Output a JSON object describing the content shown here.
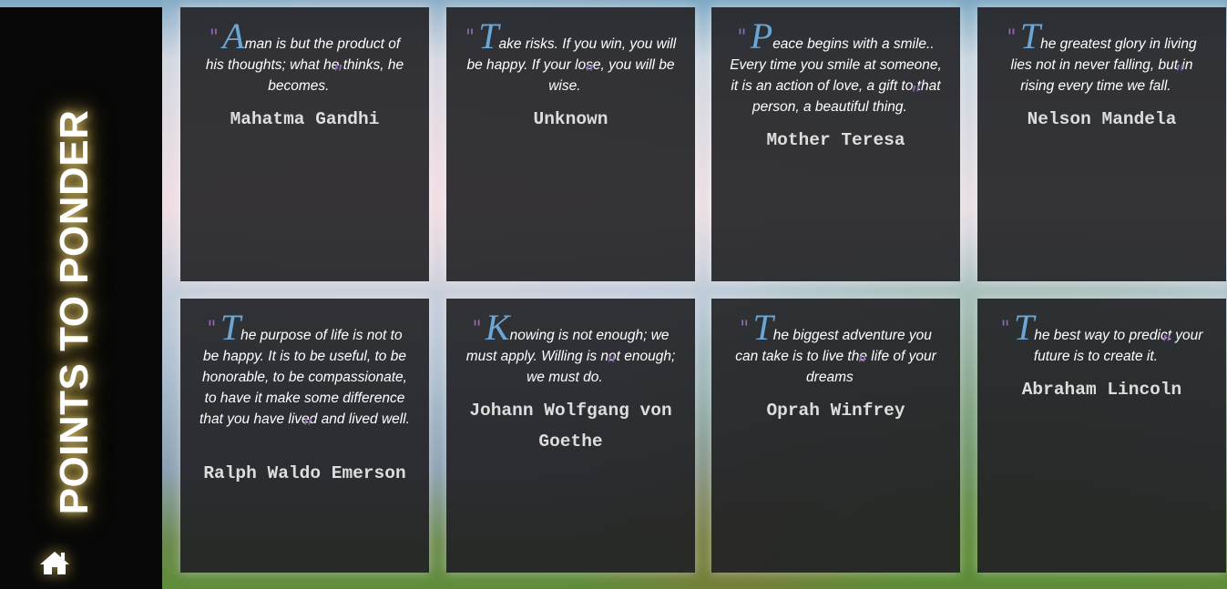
{
  "title": "POINTS TO PONDER",
  "home_icon": "home-icon",
  "quotes": [
    {
      "first": "A",
      "rest": "man is but the product of his thoughts; what he thinks, he becomes.",
      "author": "Mahatma Gandhi"
    },
    {
      "first": "T",
      "rest": "ake risks. If you win, you will be happy. If your lose, you will be wise.",
      "author": "Unknown"
    },
    {
      "first": "P",
      "rest": "eace begins with a smile.. Every time you smile at someone, it is an action of love, a gift to that person, a beautiful thing.",
      "author": "Mother Teresa"
    },
    {
      "first": "T",
      "rest": "he greatest glory in living lies not in never falling, but in rising every time we fall.",
      "author": "Nelson Mandela"
    },
    {
      "first": "T",
      "rest": "he purpose of life is not to be happy. It is to be useful, to be honorable, to be compassionate, to have it make some difference that you have lived and lived well.",
      "author": "Ralph Waldo Emerson"
    },
    {
      "first": "K",
      "rest": "nowing is not enough; we must apply. Willing is not enough; we must do.",
      "author": "Johann Wolfgang von Goethe"
    },
    {
      "first": "T",
      "rest": "he biggest adventure you can take is to live the life of your dreams",
      "author": "Oprah Winfrey"
    },
    {
      "first": "T",
      "rest": "he best way to predict your future is to create it.",
      "author": "Abraham Lincoln"
    }
  ]
}
